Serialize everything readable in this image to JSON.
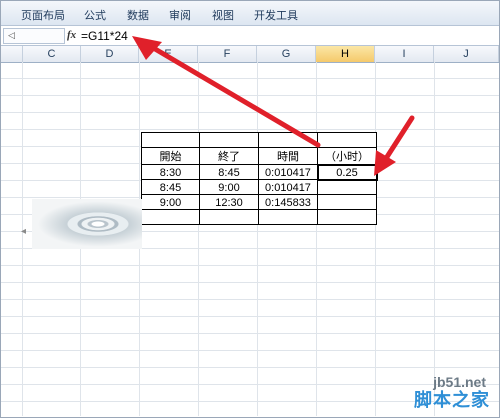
{
  "ribbon": {
    "tabs": [
      "页面布局",
      "公式",
      "数据",
      "审阅",
      "视图",
      "开发工具"
    ]
  },
  "formula_bar": {
    "fx_label": "fx",
    "formula": "=G11*24"
  },
  "columns": [
    "C",
    "D",
    "E",
    "F",
    "G",
    "H",
    "I",
    "J"
  ],
  "selected_column": "H",
  "table": {
    "header": [
      "開始",
      "終了",
      "時間",
      "（小时）"
    ],
    "rows": [
      [
        "8:30",
        "8:45",
        "0:010417",
        "0.25"
      ],
      [
        "8:45",
        "9:00",
        "0:010417",
        ""
      ],
      [
        "9:00",
        "12:30",
        "0:145833",
        ""
      ]
    ]
  },
  "watermark": {
    "url": "jb51.net",
    "name": "脚本之家"
  },
  "colors": {
    "arrow": "#e0202a",
    "ribbon_text": "#1e395b",
    "selected_header": "#f5c96b"
  }
}
